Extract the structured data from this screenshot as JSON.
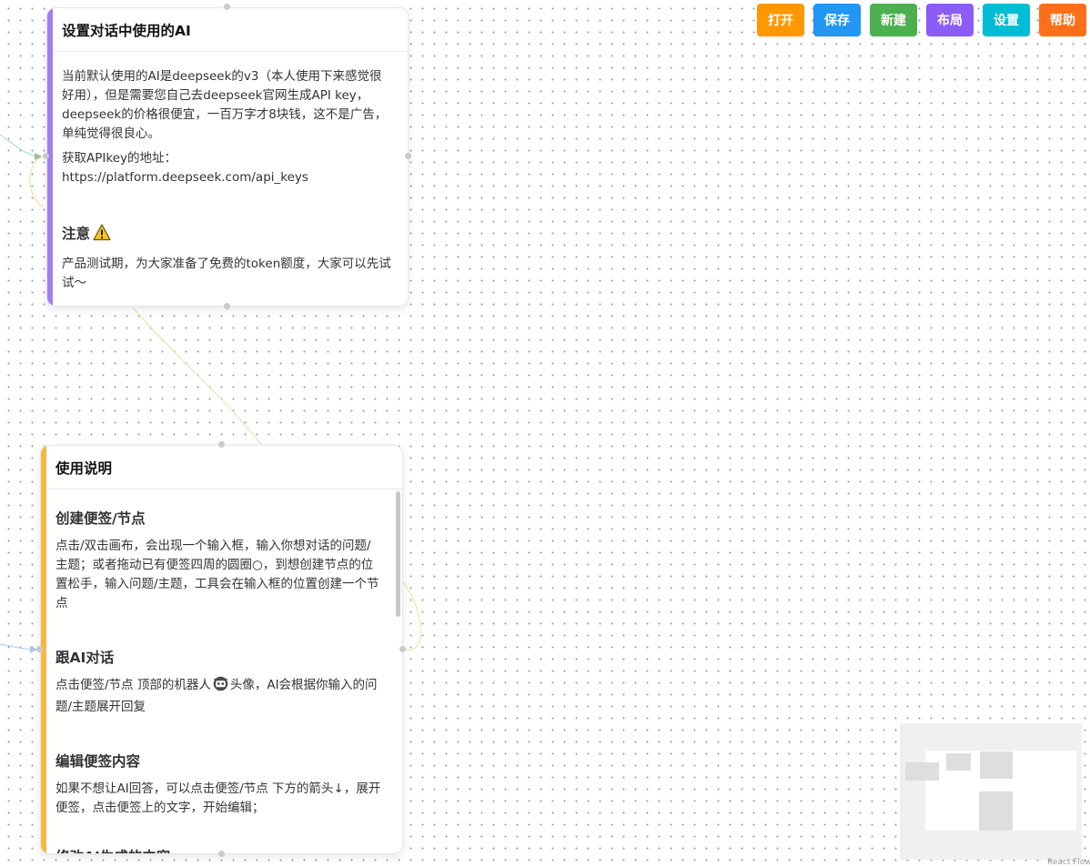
{
  "toolbar": {
    "buttons": [
      {
        "label": "打开",
        "color": "#ff9800"
      },
      {
        "label": "保存",
        "color": "#2196f3"
      },
      {
        "label": "新建",
        "color": "#4caf50"
      },
      {
        "label": "布局",
        "color": "#8b5cf6"
      },
      {
        "label": "设置",
        "color": "#00bcd4"
      },
      {
        "label": "帮助",
        "color": "#ff6f1a"
      }
    ]
  },
  "ai_node": {
    "title": "设置对话中使用的AI",
    "accent": "#a57cf2",
    "para1": "当前默认使用的AI是deepseek的v3（本人使用下来感觉很好用），但是需要您自己去deepseek官网生成API key，deepseek的价格很便宜，一百万字才8块钱，这不是广告，单纯觉得很良心。",
    "apikey_label": "获取APIkey的地址：",
    "apikey_url": "https://platform.deepseek.com/api_keys",
    "notice_heading": "注意",
    "notice_text": "产品测试期，为大家准备了免费的token额度，大家可以先试试～"
  },
  "help_node": {
    "title": "使用说明",
    "accent": "#f5b942",
    "sections": [
      {
        "heading": "创建便签/节点",
        "text": "点击/双击画布，会出现一个输入框，输入你想对话的问题/主题；或者拖动已有便签四周的圆圈○，到想创建节点的位置松手，输入问题/主题，工具会在输入框的位置创建一个节点"
      },
      {
        "heading": "跟AI对话",
        "text_before": "点击便签/节点 顶部的机器人",
        "text_after": "头像，AI会根据你输入的问题/主题展开回复"
      },
      {
        "heading": "编辑便签内容",
        "text": "如果不想让AI回答，可以点击便签/节点 下方的箭头↓，展开便签，点击便签上的文字，开始编辑；"
      },
      {
        "heading": "修改AI生成的内容"
      }
    ]
  },
  "minimap": {
    "attribution": "React Flow"
  }
}
